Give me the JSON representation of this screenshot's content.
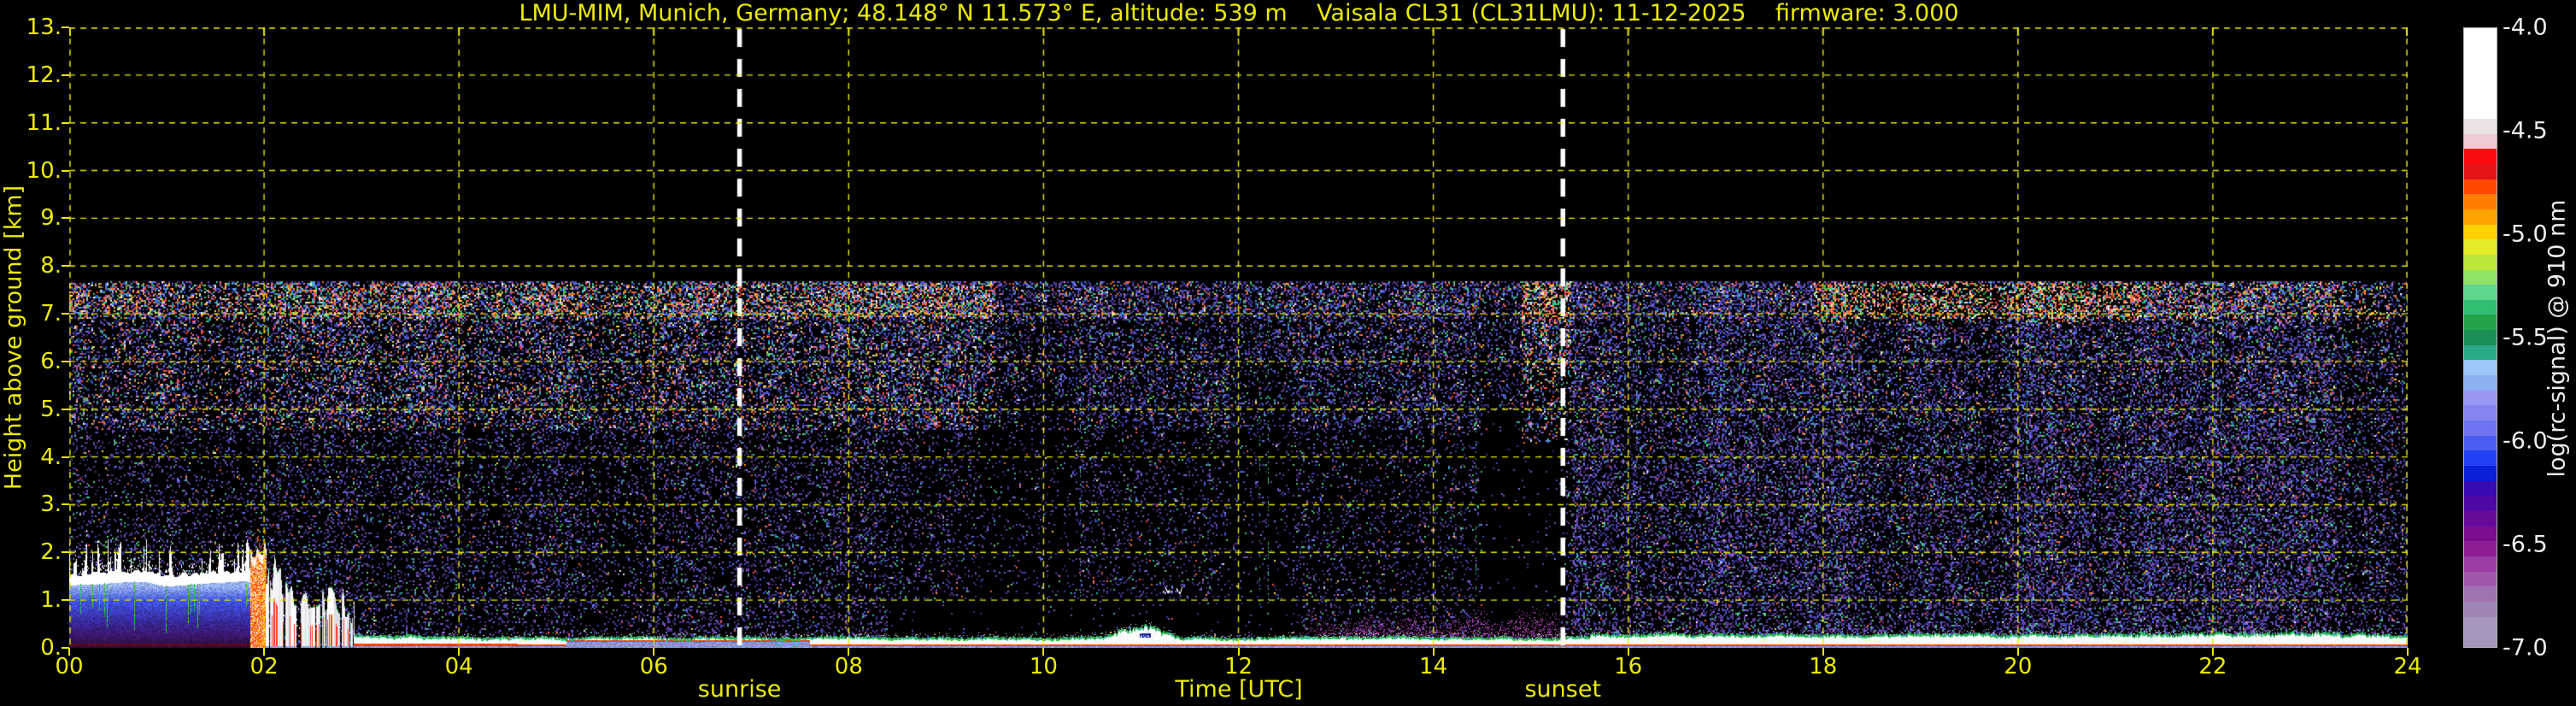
{
  "title": "LMU-MIM, Munich, Germany; 48.148° N 11.573° E, altitude: 539 m    Vaisala CL31 (CL31LMU): 11-12-2025    firmware: 3.000",
  "axes": {
    "x": {
      "label": "Time [UTC]",
      "range_hours": [
        0,
        24
      ],
      "ticks": [
        "00",
        "02",
        "04",
        "06",
        "08",
        "10",
        "12",
        "14",
        "16",
        "18",
        "20",
        "22",
        "24"
      ]
    },
    "y": {
      "label": "Height above ground [km]",
      "range_km": [
        0,
        13
      ],
      "ticks": [
        "13.",
        "12.",
        "11.",
        "10.",
        "9.",
        "8.",
        "7.",
        "6.",
        "5.",
        "4.",
        "3.",
        "2.",
        "1.",
        "0."
      ]
    }
  },
  "annotations": {
    "sunrise": {
      "label": "sunrise",
      "time_utc_hours": 6.88
    },
    "sunset": {
      "label": "sunset",
      "time_utc_hours": 15.33
    }
  },
  "colorbar": {
    "label": "log(rc-signal) @ 910 nm",
    "ticks": [
      "-4.0",
      "-4.5",
      "-5.0",
      "-5.5",
      "-6.0",
      "-6.5",
      "-7.0"
    ],
    "range": [
      -4.0,
      -7.0
    ],
    "segments": [
      {
        "c": "#ffffff",
        "s": 6
      },
      {
        "c": "#ece3e4",
        "s": 1
      },
      {
        "c": "#f0ccd2",
        "s": 1
      },
      {
        "c": "#fb0a10",
        "s": 1
      },
      {
        "c": "#e41418",
        "s": 1
      },
      {
        "c": "#ff4800",
        "s": 1
      },
      {
        "c": "#ff7c00",
        "s": 1
      },
      {
        "c": "#ffa200",
        "s": 1
      },
      {
        "c": "#ffd200",
        "s": 1
      },
      {
        "c": "#e6ec2c",
        "s": 1
      },
      {
        "c": "#bae73a",
        "s": 1
      },
      {
        "c": "#90e266",
        "s": 1
      },
      {
        "c": "#5dd68c",
        "s": 1
      },
      {
        "c": "#33bd72",
        "s": 1
      },
      {
        "c": "#23a44b",
        "s": 1
      },
      {
        "c": "#1b8f55",
        "s": 1
      },
      {
        "c": "#2aa988",
        "s": 1
      },
      {
        "c": "#9dc7f8",
        "s": 1
      },
      {
        "c": "#8db2f4",
        "s": 1
      },
      {
        "c": "#9898f2",
        "s": 1
      },
      {
        "c": "#8585f0",
        "s": 1
      },
      {
        "c": "#6e74f2",
        "s": 1
      },
      {
        "c": "#4a5cf2",
        "s": 1
      },
      {
        "c": "#2442f5",
        "s": 1
      },
      {
        "c": "#0a1fd8",
        "s": 1
      },
      {
        "c": "#3709b0",
        "s": 1
      },
      {
        "c": "#4f07a6",
        "s": 1
      },
      {
        "c": "#650b9a",
        "s": 1
      },
      {
        "c": "#7a0c8e",
        "s": 1
      },
      {
        "c": "#8c1d93",
        "s": 1
      },
      {
        "c": "#9a3da4",
        "s": 1
      },
      {
        "c": "#a057ab",
        "s": 1
      },
      {
        "c": "#9f72b0",
        "s": 1
      },
      {
        "c": "#9d86b5",
        "s": 1
      },
      {
        "c": "#a696bd",
        "s": 2
      }
    ]
  },
  "chart_data": {
    "type": "heatmap",
    "title": "Ceilometer attenuated backscatter quicklook, Vaisala CL31, Munich, 11-12-2025",
    "xlabel": "Time [UTC]",
    "ylabel": "Height above ground [km]",
    "value_label": "log(rc-signal) @ 910 nm",
    "x_range_hours": [
      0,
      24
    ],
    "y_range_km": [
      0,
      13
    ],
    "value_range": [
      -4.0,
      -7.0
    ],
    "sunrise_utc_hours": 6.88,
    "sunset_utc_hours": 15.33,
    "features": {
      "noise_ceiling_km": 7.68,
      "stratus_cloud": {
        "time_utc": [
          0,
          1.86
        ],
        "base_km": 1.35,
        "top_km": 1.75,
        "note": "low stratus deck with spiky top (white, signal > -4.5); blue-to-purple backscatter below it down to the ground"
      },
      "rain_onset": {
        "time_utc": [
          1.86,
          2.02
        ],
        "top_km": 2.1,
        "note": "red/orange column of enhanced backscatter at cloud breakup"
      },
      "precipitation": {
        "time_utc": [
          2.02,
          2.92
        ],
        "top_km_start": 1.5,
        "top_km_end": 0.8,
        "note": "saturated white precipitation streaks reaching the ground, tops descending"
      },
      "surface_layer": {
        "time_utc": [
          2.92,
          24
        ],
        "typical_top_km": 0.2,
        "note": "persistent shallow fog/stratus layer at the surface all day: white core, red fringe below, green fringe on top, blue near ground"
      },
      "surface_layer_bump": {
        "time_utc": [
          10.6,
          11.4
        ],
        "top_km": 0.45
      },
      "dark_notch": {
        "time_utc": [
          10.98,
          11.1
        ],
        "height_km": [
          0.2,
          0.3
        ]
      },
      "moist_layer": {
        "time_utc": [
          5.1,
          7.6
        ],
        "blue_top_km": 0.11
      },
      "aerosol_haze": {
        "time_utc": [
          12.6,
          15.42
        ],
        "top_km": 0.85,
        "note": "magenta/purple aerosol haze above the surface layer in the afternoon"
      },
      "small_cloud": {
        "time_utc": [
          11.22,
          11.42
        ],
        "base_km": 1.17,
        "top_km": 1.28
      },
      "clean_zones": [
        {
          "time_utc": [
            8.4,
            12.55
          ],
          "height_km": [
            0.28,
            1.05
          ],
          "factor": 0.12
        },
        {
          "time_utc": [
            14.5,
            15.33
          ],
          "height_km": [
            0.3,
            5.0
          ],
          "factor": 0.15
        },
        {
          "time_utc": [
            11.9,
            12.55
          ],
          "height_km": [
            1.0,
            6.0
          ],
          "factor": 0.55
        },
        {
          "time_utc": [
            9.3,
            10.3
          ],
          "height_km": [
            0.3,
            5.5
          ],
          "factor": 0.6
        }
      ],
      "colorful_noise_bands": [
        {
          "time_utc": [
            0,
            9.5
          ],
          "height_km": [
            4.6,
            7.68
          ],
          "intensity": 0.55
        },
        {
          "time_utc": [
            17.9,
            21.3
          ],
          "height_km": [
            6.85,
            7.68
          ],
          "intensity": 0.8
        },
        {
          "time_utc": [
            14.9,
            15.4
          ],
          "height_km": [
            4.3,
            7.68
          ],
          "intensity": 0.8,
          "note": "plume"
        },
        {
          "time_utc": [
            21.3,
            24
          ],
          "height_km": [
            6.85,
            7.68
          ],
          "intensity": 0.45
        }
      ],
      "post_sunset_noise": {
        "time_utc": [
          15.45,
          24
        ],
        "note": "background-free purple speckle noise down to the ground with vertical striping after sunset"
      }
    }
  }
}
